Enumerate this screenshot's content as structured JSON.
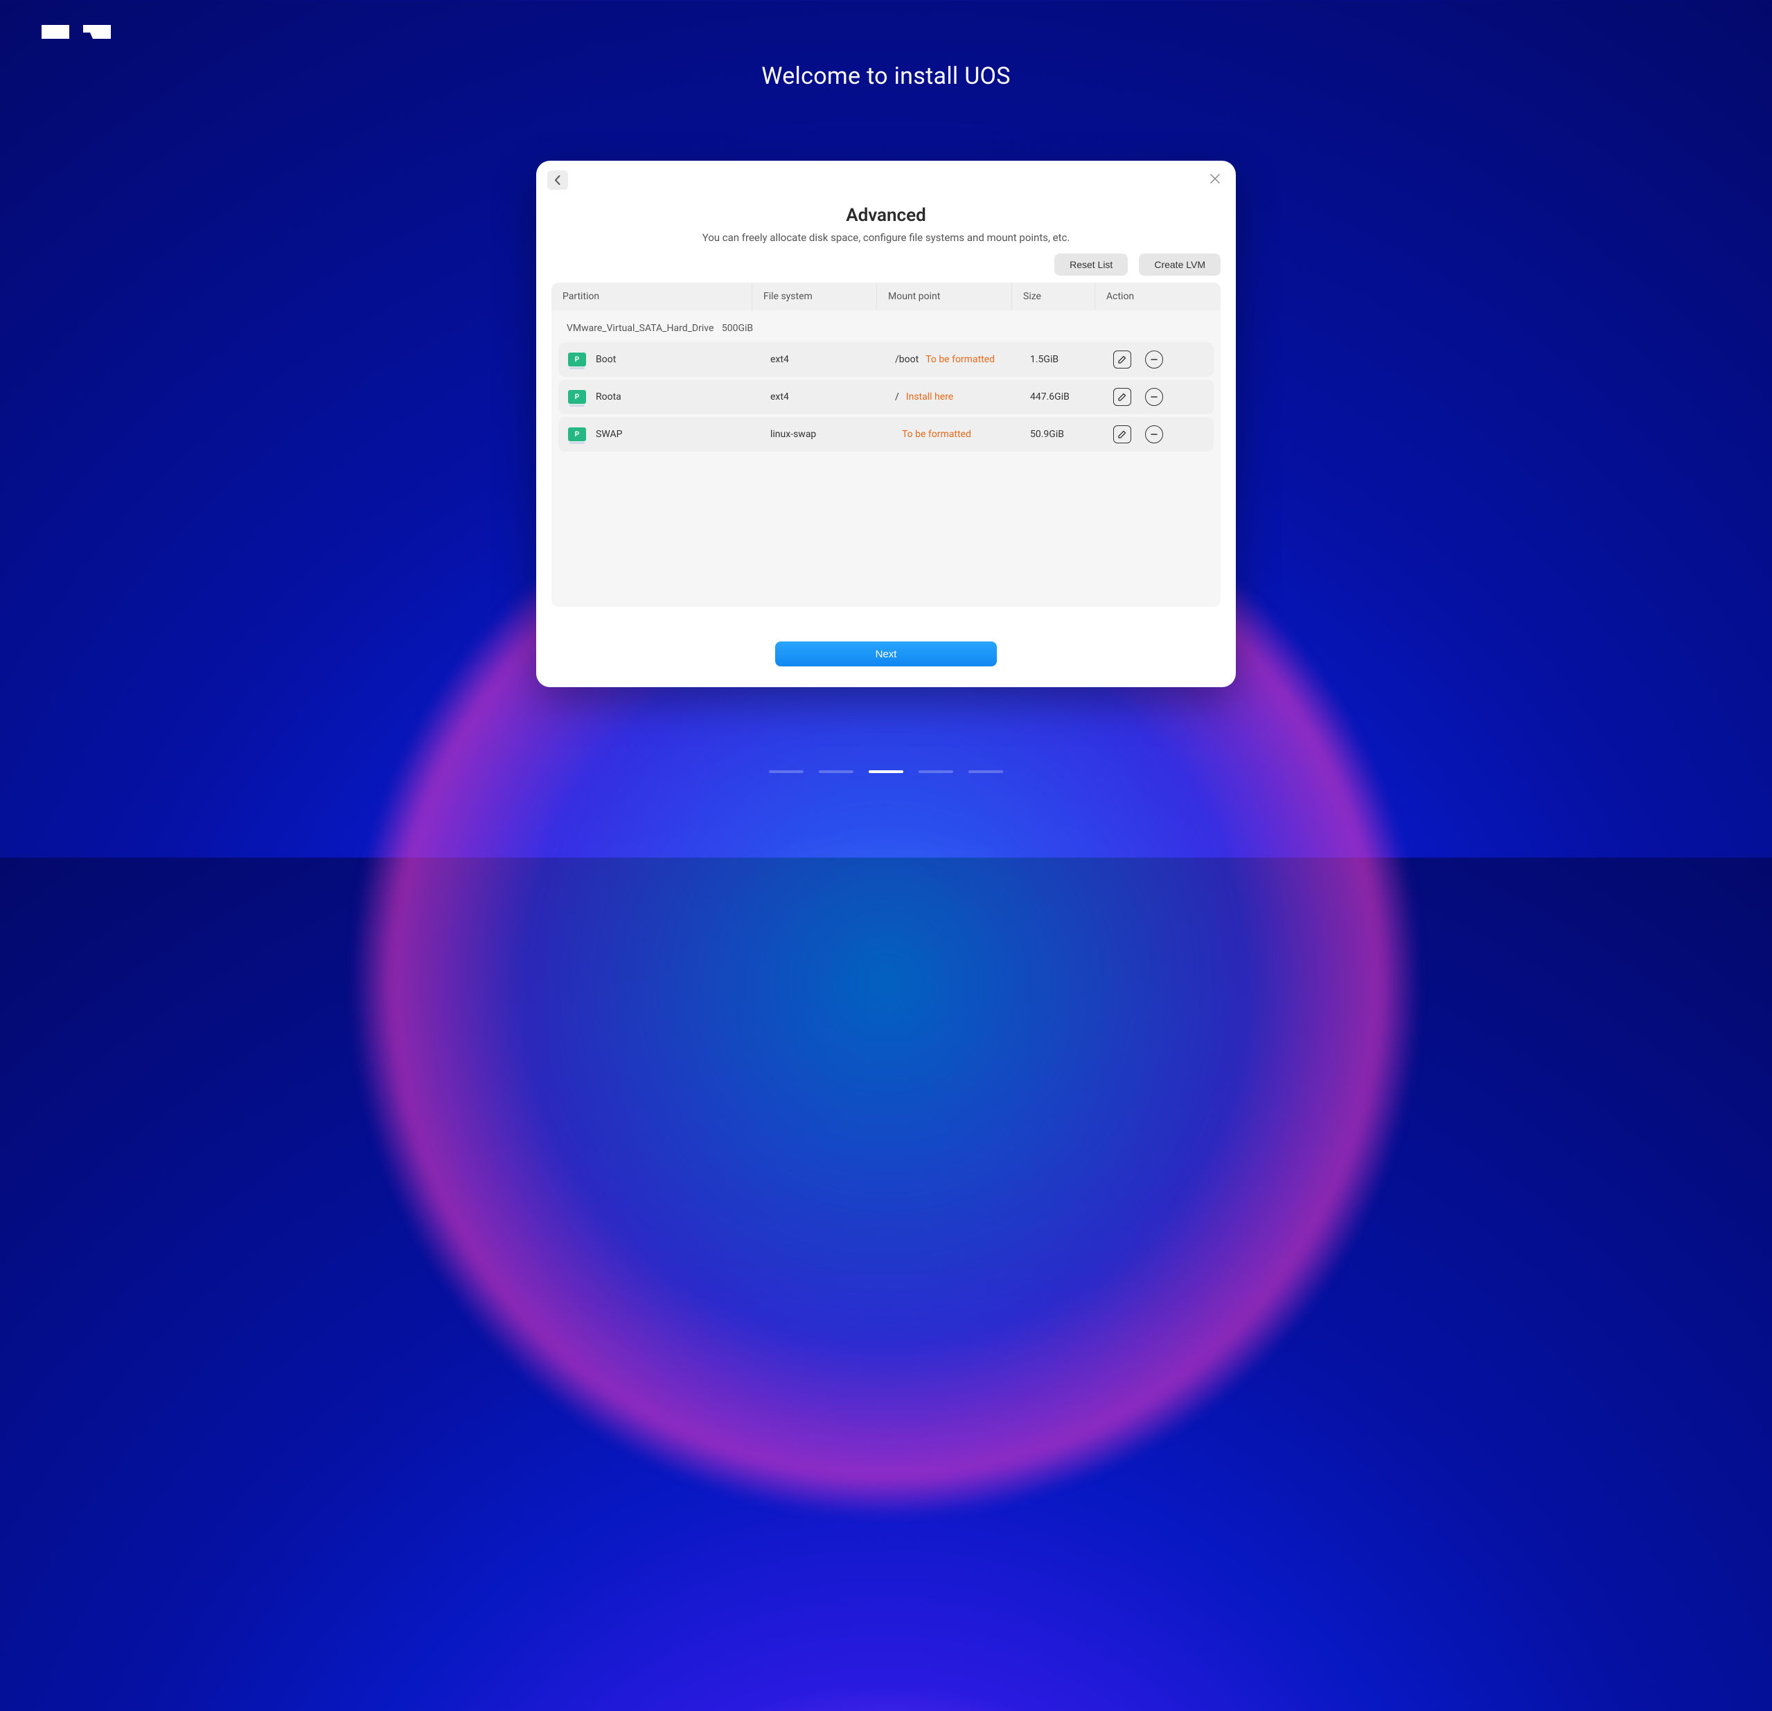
{
  "headline": "Welcome to install UOS",
  "dialog": {
    "title": "Advanced",
    "subtitle": "You can freely allocate disk space, configure file systems and mount points, etc.",
    "reset_label": "Reset List",
    "create_lvm_label": "Create LVM",
    "next_label": "Next"
  },
  "columns": {
    "partition": "Partition",
    "filesystem": "File system",
    "mount": "Mount point",
    "size": "Size",
    "action": "Action"
  },
  "drive": {
    "name": "VMware_Virtual_SATA_Hard_Drive",
    "size": "500GiB"
  },
  "icon_label": "P",
  "partitions": [
    {
      "name": "Boot",
      "fs": "ext4",
      "mount": "/boot",
      "status": "To be formatted",
      "size": "1.5GiB"
    },
    {
      "name": "Roota",
      "fs": "ext4",
      "mount": "/",
      "status": "Install here",
      "size": "447.6GiB"
    },
    {
      "name": "SWAP",
      "fs": "linux-swap",
      "mount": "",
      "status": "To be formatted",
      "size": "50.9GiB"
    }
  ],
  "steps": {
    "total": 5,
    "active_index": 2
  }
}
